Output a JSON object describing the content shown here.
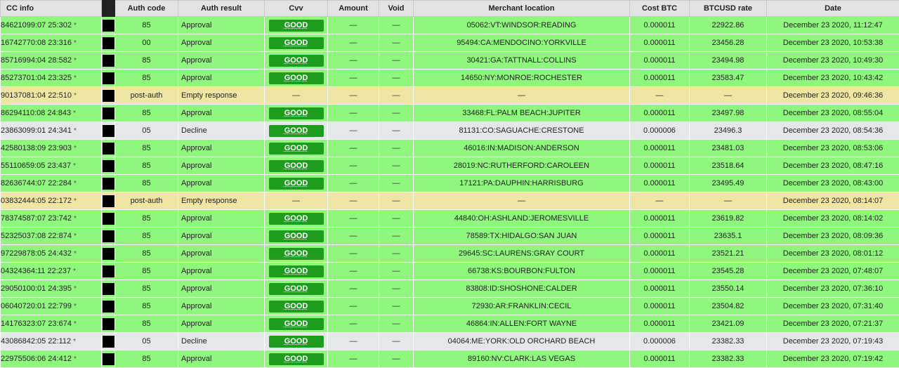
{
  "headers": {
    "cc_info": "CC info",
    "auth_code": "Auth code",
    "auth_result": "Auth result",
    "cvv": "Cvv",
    "amount": "Amount",
    "void": "Void",
    "merchant_location": "Merchant location",
    "cost_btc": "Cost BTC",
    "btcusd_rate": "BTCUSD rate",
    "date": "Date"
  },
  "colors": {
    "approval": "#8ff77d",
    "decline": "#e4e8eb",
    "post_auth": "#f0e6a4",
    "good_badge": "#1e9c1e"
  },
  "rows": [
    {
      "cc": "84621099:07 25:302",
      "marker": "*",
      "auth_code": "85",
      "auth_result": "Approval",
      "cvv": "GOOD",
      "amount": "—",
      "void": "—",
      "merchant": "05062:VT:WINDSOR:READING",
      "cost": "0.000011",
      "rate": "22922.86",
      "date": "December 23 2020, 11:12:47",
      "status": "approval"
    },
    {
      "cc": "16742770:08 23:316",
      "marker": "*",
      "auth_code": "00",
      "auth_result": "Approval",
      "cvv": "GOOD",
      "amount": "—",
      "void": "—",
      "merchant": "95494:CA:MENDOCINO:YORKVILLE",
      "cost": "0.000011",
      "rate": "23456.28",
      "date": "December 23 2020, 10:53:38",
      "status": "approval"
    },
    {
      "cc": "85716994:04 28:582",
      "marker": "*",
      "auth_code": "85",
      "auth_result": "Approval",
      "cvv": "GOOD",
      "amount": "—",
      "void": "—",
      "merchant": "30421:GA:TATTNALL:COLLINS",
      "cost": "0.000011",
      "rate": "23494.98",
      "date": "December 23 2020, 10:49:30",
      "status": "approval"
    },
    {
      "cc": "85273701:04 23:325",
      "marker": "*",
      "auth_code": "85",
      "auth_result": "Approval",
      "cvv": "GOOD",
      "amount": "—",
      "void": "—",
      "merchant": "14650:NY:MONROE:ROCHESTER",
      "cost": "0.000011",
      "rate": "23583.47",
      "date": "December 23 2020, 10:43:42",
      "status": "approval"
    },
    {
      "cc": "90137081:04 22:510",
      "marker": "*",
      "auth_code": "post-auth",
      "auth_result": "Empty response",
      "cvv": "—",
      "amount": "—",
      "void": "—",
      "merchant": "—",
      "cost": "—",
      "rate": "—",
      "date": "December 23 2020, 09:46:36",
      "status": "post"
    },
    {
      "cc": "86294110:08 24:843",
      "marker": "*",
      "auth_code": "85",
      "auth_result": "Approval",
      "cvv": "GOOD",
      "amount": "—",
      "void": "—",
      "merchant": "33468:FL:PALM BEACH:JUPITER",
      "cost": "0.000011",
      "rate": "23497.98",
      "date": "December 23 2020, 08:55:04",
      "status": "approval"
    },
    {
      "cc": "23863099:01 24:341",
      "marker": "*",
      "auth_code": "05",
      "auth_result": "Decline",
      "cvv": "GOOD",
      "amount": "—",
      "void": "—",
      "merchant": "81131:CO:SAGUACHE:CRESTONE",
      "cost": "0.000006",
      "rate": "23496.3",
      "date": "December 23 2020, 08:54:36",
      "status": "decline"
    },
    {
      "cc": "42580138:09 23:903",
      "marker": "*",
      "auth_code": "85",
      "auth_result": "Approval",
      "cvv": "GOOD",
      "amount": "—",
      "void": "—",
      "merchant": "46016:IN:MADISON:ANDERSON",
      "cost": "0.000011",
      "rate": "23481.03",
      "date": "December 23 2020, 08:53:06",
      "status": "approval"
    },
    {
      "cc": "55110659:05 23:437",
      "marker": "*",
      "auth_code": "85",
      "auth_result": "Approval",
      "cvv": "GOOD",
      "amount": "—",
      "void": "—",
      "merchant": "28019:NC:RUTHERFORD:CAROLEEN",
      "cost": "0.000011",
      "rate": "23518.64",
      "date": "December 23 2020, 08:47:16",
      "status": "approval"
    },
    {
      "cc": "82636744:07 22:284",
      "marker": "*",
      "auth_code": "85",
      "auth_result": "Approval",
      "cvv": "GOOD",
      "amount": "—",
      "void": "—",
      "merchant": "17121:PA:DAUPHIN:HARRISBURG",
      "cost": "0.000011",
      "rate": "23495.49",
      "date": "December 23 2020, 08:43:00",
      "status": "approval"
    },
    {
      "cc": "03832444:05 22:172",
      "marker": "*",
      "auth_code": "post-auth",
      "auth_result": "Empty response",
      "cvv": "—",
      "amount": "—",
      "void": "—",
      "merchant": "—",
      "cost": "—",
      "rate": "—",
      "date": "December 23 2020, 08:14:07",
      "status": "post"
    },
    {
      "cc": "78374587:07 23:742",
      "marker": "*",
      "auth_code": "85",
      "auth_result": "Approval",
      "cvv": "GOOD",
      "amount": "—",
      "void": "—",
      "merchant": "44840:OH:ASHLAND:JEROMESVILLE",
      "cost": "0.000011",
      "rate": "23619.82",
      "date": "December 23 2020, 08:14:02",
      "status": "approval"
    },
    {
      "cc": "52325037:08 22:874",
      "marker": "*",
      "auth_code": "85",
      "auth_result": "Approval",
      "cvv": "GOOD",
      "amount": "—",
      "void": "—",
      "merchant": "78589:TX:HIDALGO:SAN JUAN",
      "cost": "0.000011",
      "rate": "23635.1",
      "date": "December 23 2020, 08:09:36",
      "status": "approval"
    },
    {
      "cc": "97229878:05 24:432",
      "marker": "*",
      "auth_code": "85",
      "auth_result": "Approval",
      "cvv": "GOOD",
      "amount": "—",
      "void": "—",
      "merchant": "29645:SC:LAURENS:GRAY COURT",
      "cost": "0.000011",
      "rate": "23521.21",
      "date": "December 23 2020, 08:01:12",
      "status": "approval"
    },
    {
      "cc": "04324364:11 22:237",
      "marker": "*",
      "auth_code": "85",
      "auth_result": "Approval",
      "cvv": "GOOD",
      "amount": "—",
      "void": "—",
      "merchant": "66738:KS:BOURBON:FULTON",
      "cost": "0.000011",
      "rate": "23545.28",
      "date": "December 23 2020, 07:48:07",
      "status": "approval"
    },
    {
      "cc": "29050100:01 24:395",
      "marker": "*",
      "auth_code": "85",
      "auth_result": "Approval",
      "cvv": "GOOD",
      "amount": "—",
      "void": "—",
      "merchant": "83808:ID:SHOSHONE:CALDER",
      "cost": "0.000011",
      "rate": "23550.14",
      "date": "December 23 2020, 07:36:10",
      "status": "approval"
    },
    {
      "cc": "06040720:01 22:799",
      "marker": "*",
      "auth_code": "85",
      "auth_result": "Approval",
      "cvv": "GOOD",
      "amount": "—",
      "void": "—",
      "merchant": "72930:AR:FRANKLIN:CECIL",
      "cost": "0.000011",
      "rate": "23504.82",
      "date": "December 23 2020, 07:31:40",
      "status": "approval"
    },
    {
      "cc": "14176323:07 23:674",
      "marker": "*",
      "auth_code": "85",
      "auth_result": "Approval",
      "cvv": "GOOD",
      "amount": "—",
      "void": "—",
      "merchant": "46864:IN:ALLEN:FORT WAYNE",
      "cost": "0.000011",
      "rate": "23421.09",
      "date": "December 23 2020, 07:21:37",
      "status": "approval"
    },
    {
      "cc": "43086842:05 22:112",
      "marker": "*",
      "auth_code": "05",
      "auth_result": "Decline",
      "cvv": "GOOD",
      "amount": "—",
      "void": "—",
      "merchant": "04064:ME:YORK:OLD ORCHARD BEACH",
      "cost": "0.000006",
      "rate": "23382.33",
      "date": "December 23 2020, 07:19:43",
      "status": "decline"
    },
    {
      "cc": "22975506:06 24:412",
      "marker": "*",
      "auth_code": "85",
      "auth_result": "Approval",
      "cvv": "GOOD",
      "amount": "—",
      "void": "—",
      "merchant": "89160:NV:CLARK:LAS VEGAS",
      "cost": "0.000011",
      "rate": "23382.33",
      "date": "December 23 2020, 07:19:42",
      "status": "approval"
    }
  ]
}
